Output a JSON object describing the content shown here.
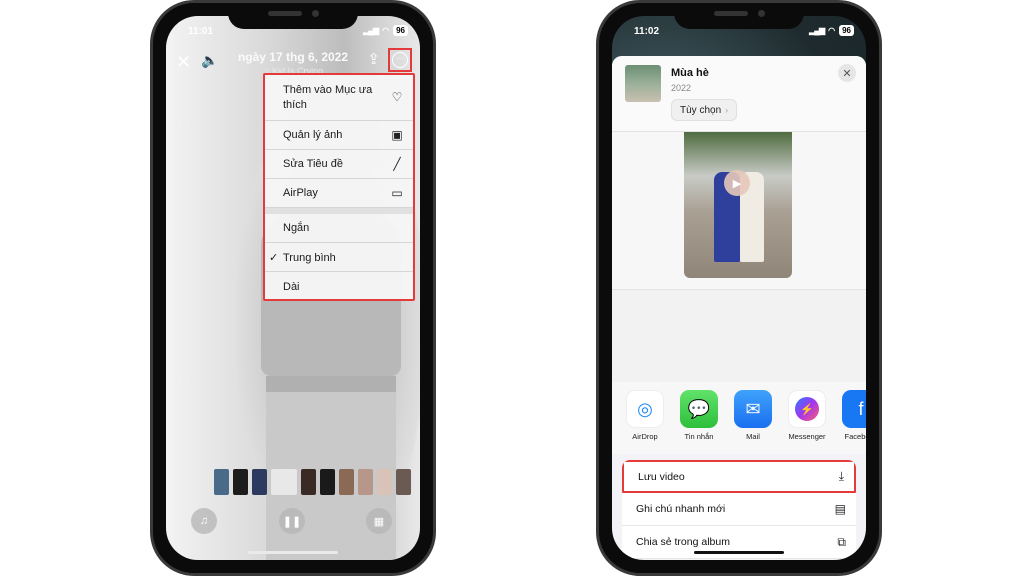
{
  "left_phone": {
    "status": {
      "time": "11:01",
      "battery": "96"
    },
    "header": {
      "title": "ngày 17 thg 6, 2022",
      "subtitle": "♫ Kid Is Crying",
      "close_icon": "✕",
      "speaker_icon": "🔈",
      "share_icon": "⇪",
      "more_icon": "···"
    },
    "menu": {
      "items": [
        {
          "label": "Thêm vào Mục ưa thích",
          "icon": "♡"
        },
        {
          "label": "Quản lý ảnh",
          "icon": "▣"
        },
        {
          "label": "Sửa Tiêu đề",
          "icon": "╱"
        },
        {
          "label": "AirPlay",
          "icon": "▭"
        }
      ],
      "durations": [
        {
          "label": "Ngắn",
          "checked": false
        },
        {
          "label": "Trung bình",
          "checked": true
        },
        {
          "label": "Dài",
          "checked": false
        }
      ],
      "check_mark": "✓"
    },
    "controls": {
      "music_icon": "♫",
      "pause_icon": "❚❚",
      "grid_icon": "▦"
    },
    "thumbnail_colors": [
      "#4a6a8a",
      "#1d1d1d",
      "#2b3a5e",
      "#e8e8e8",
      "#3a2a26",
      "#1a1a1a",
      "#8a6a55",
      "#b8968a",
      "#d9c3b8",
      "#6a5a52"
    ]
  },
  "right_phone": {
    "status": {
      "time": "11:02",
      "battery": "96"
    },
    "share_sheet": {
      "album_title": "Mùa hè",
      "album_year": "2022",
      "options_label": "Tùy chọn",
      "options_chevron": "›",
      "close_icon": "✕",
      "play_icon": "▶"
    },
    "apps": [
      {
        "label": "AirDrop",
        "icon": "◎"
      },
      {
        "label": "Tin nhắn",
        "icon": "💬"
      },
      {
        "label": "Mail",
        "icon": "✉"
      },
      {
        "label": "Messenger",
        "icon": "⚡"
      },
      {
        "label": "Facebook",
        "icon": "f"
      }
    ],
    "actions": [
      {
        "label": "Lưu video",
        "icon": "⤓",
        "highlighted": true
      },
      {
        "label": "Ghi chú nhanh mới",
        "icon": "▤",
        "highlighted": false
      },
      {
        "label": "Chia sẻ trong album",
        "icon": "⧉",
        "highlighted": false
      }
    ]
  },
  "accent_colors": {
    "highlight_red": "#e53a3a"
  }
}
